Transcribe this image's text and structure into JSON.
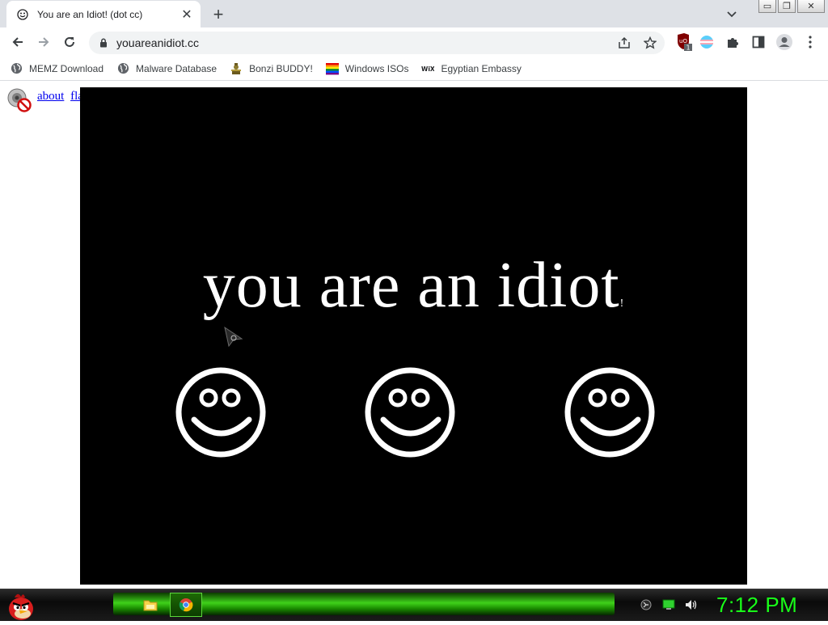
{
  "browser": {
    "tab": {
      "title": "You are an Idiot! (dot cc)",
      "close_glyph": "✕"
    },
    "new_tab_glyph": "+",
    "window_controls": {
      "minimize": "▭",
      "restore": "❐",
      "close": "✕"
    },
    "address": {
      "url": "youareanidiot.cc"
    },
    "extensions": {
      "ublock_badge": "1"
    },
    "bookmarks": [
      {
        "label": "MEMZ Download",
        "icon": "globe-icon"
      },
      {
        "label": "Malware Database",
        "icon": "globe-icon"
      },
      {
        "label": "Bonzi BUDDY!",
        "icon": "bonzi-icon"
      },
      {
        "label": "Windows ISOs",
        "icon": "windows-icon"
      },
      {
        "label": "Egyptian Embassy",
        "icon": "wix-icon"
      }
    ]
  },
  "page": {
    "links": {
      "about": "about",
      "flash": "flash"
    },
    "headline": "you are an idiot",
    "headline_suffix": "!",
    "smiley_count": 3
  },
  "taskbar": {
    "clock": "7:12 PM"
  },
  "colors": {
    "accent_green": "#19ff19",
    "flash_bg": "#000000",
    "link": "#0000ee"
  }
}
